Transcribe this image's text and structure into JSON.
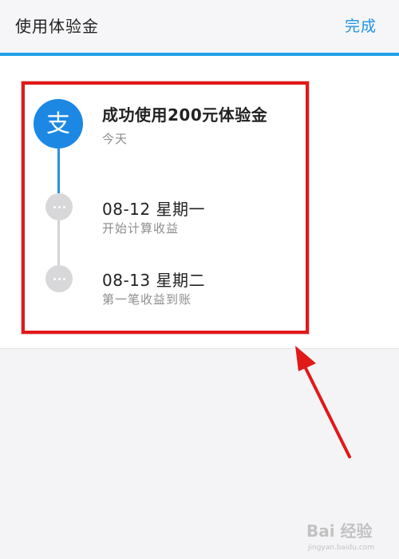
{
  "header": {
    "title": "使用体验金",
    "done_label": "完成"
  },
  "timeline": {
    "events": [
      {
        "title": "成功使用200元体验金",
        "subtitle": "今天"
      },
      {
        "title": "08-12 星期一",
        "subtitle": "开始计算收益"
      },
      {
        "title": "08-13 星期二",
        "subtitle": "第一笔收益到账"
      }
    ],
    "logo_glyph": "支"
  },
  "watermark": {
    "text": "Bai 经验",
    "subtext": "jingyan.baidu.com"
  },
  "colors": {
    "accent": "#1f93e8",
    "logo": "#1c88e4",
    "highlight": "#e01919"
  }
}
